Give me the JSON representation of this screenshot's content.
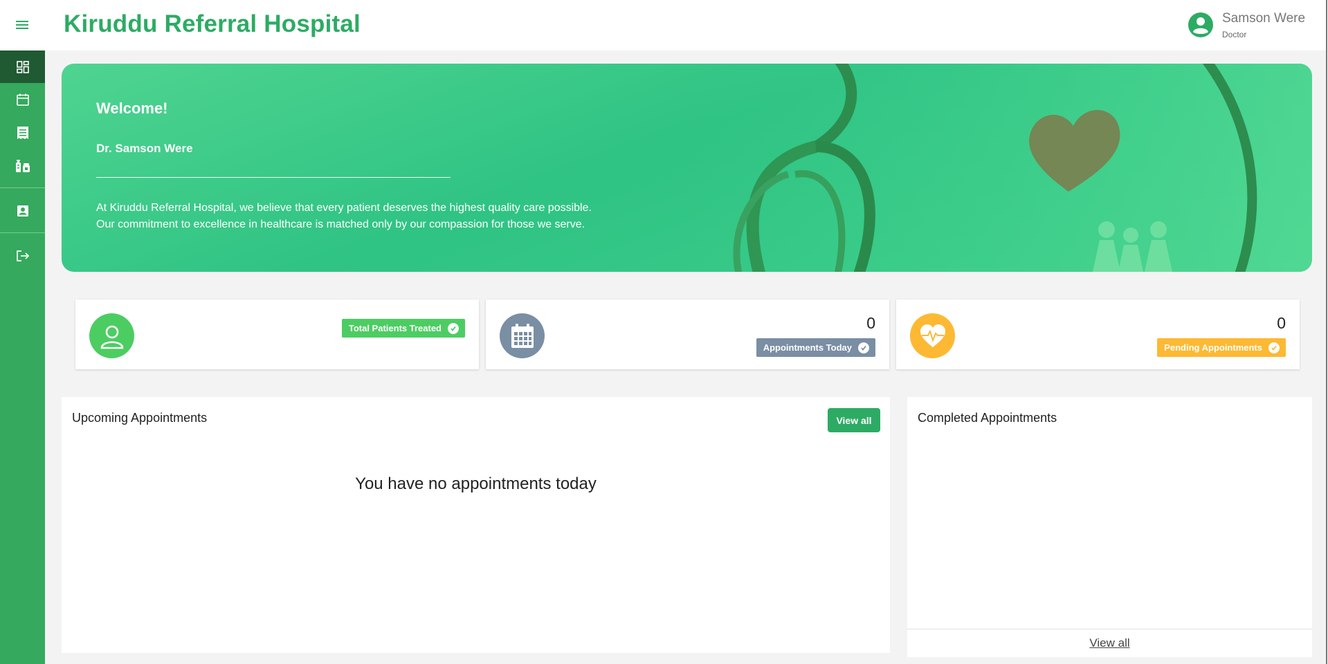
{
  "header": {
    "app_title": "Kiruddu Referral Hospital",
    "user_name": "Samson Were",
    "user_role": "Doctor"
  },
  "sidebar": {
    "items": [
      {
        "icon": "dashboard-icon",
        "active": true
      },
      {
        "icon": "calendar-icon",
        "active": false
      },
      {
        "icon": "receipt-icon",
        "active": false
      },
      {
        "icon": "medication-icon",
        "active": false
      },
      {
        "icon": "profile-card-icon",
        "active": false
      },
      {
        "icon": "logout-icon",
        "active": false
      }
    ]
  },
  "hero": {
    "title": "Welcome!",
    "doctor_name": "Dr. Samson Were",
    "line1": "At Kiruddu Referral Hospital, we believe that every patient deserves the highest quality care possible.",
    "line2": "Our commitment to excellence in healthcare is matched only by our compassion for those we serve."
  },
  "stats": [
    {
      "label": "Total Patients Treated",
      "value": "",
      "icon": "user-icon",
      "color": "#4ccd62",
      "badge_color": "#4ccd62"
    },
    {
      "label": "Appointments Today",
      "value": "0",
      "icon": "calendar-grid-icon",
      "color": "#7a8ea4",
      "badge_color": "#7a8ea4"
    },
    {
      "label": "Pending Appointments",
      "value": "0",
      "icon": "heartbeat-icon",
      "color": "#fdb933",
      "badge_color": "#fdb933"
    }
  ],
  "upcoming": {
    "title": "Upcoming Appointments",
    "view_all": "View all",
    "empty_message": "You have no appointments today"
  },
  "completed": {
    "title": "Completed Appointments",
    "view_all": "View all"
  },
  "colors": {
    "brand": "#2dab64",
    "sidebar": "#35a95d",
    "sidebar_active": "#1f5a33"
  }
}
